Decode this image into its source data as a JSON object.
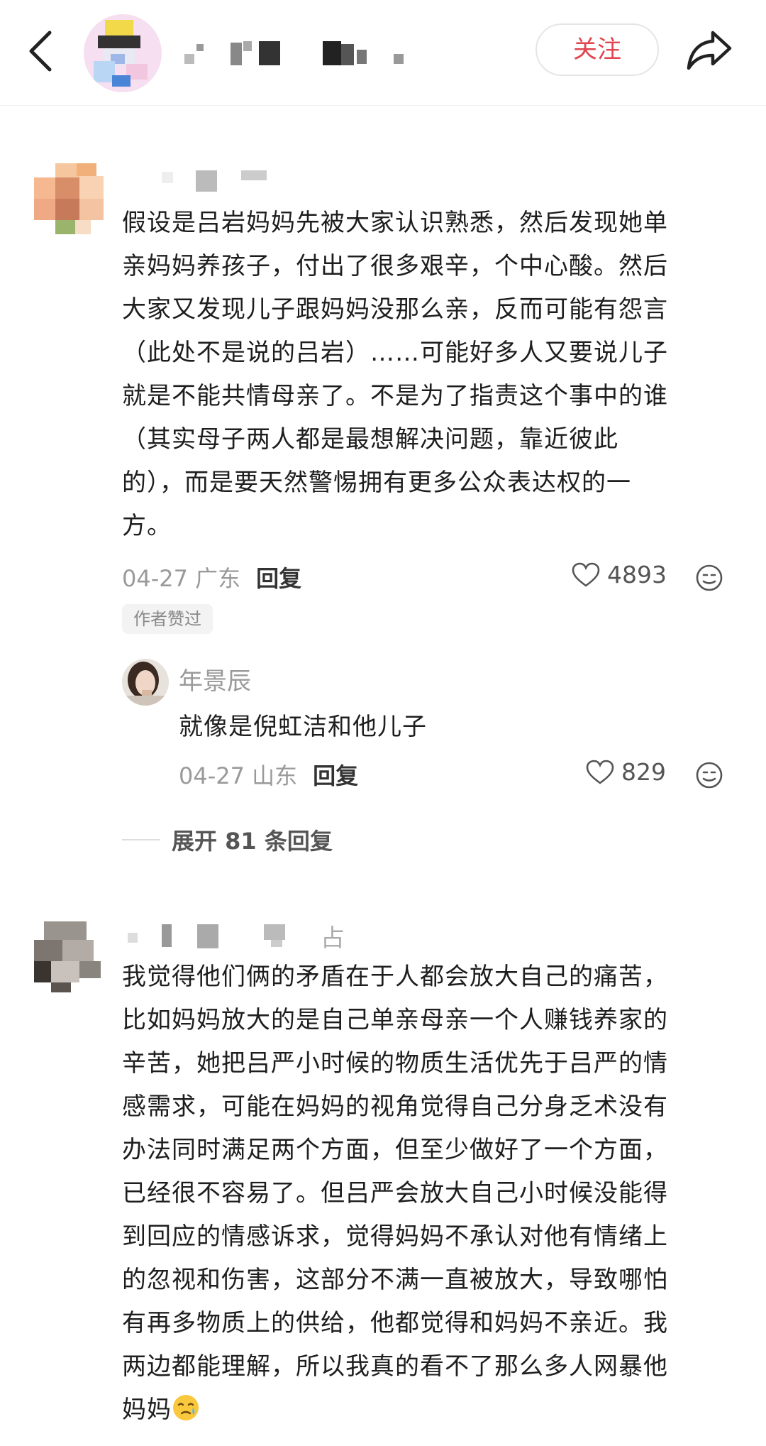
{
  "header": {
    "follow_label": "关注"
  },
  "comments": [
    {
      "text": "假设是吕岩妈妈先被大家认识熟悉，然后发现她单亲妈妈养孩子，付出了很多艰辛，个中心酸。然后大家又发现儿子跟妈妈没那么亲，反而可能有怨言（此处不是说的吕岩）……可能好多人又要说儿子就是不能共情母亲了。不是为了指责这个事中的谁（其实母子两人都是最想解决问题，靠近彼此的），而是要天然警惕拥有更多公众表达权的一方。",
      "lines": [
        "假设是吕岩妈妈先被大家认识熟悉，然后发现她单",
        "亲妈妈养孩子，付出了很多艰辛，个中心酸。然后",
        "大家又发现儿子跟妈妈没那么亲，反而可能有怨言",
        "（此处不是说的吕岩）……可能好多人又要说儿子",
        "就是不能共情母亲了。不是为了指责这个事中的谁",
        "（其实母子两人都是最想解决问题，靠近彼此",
        "的），而是要天然警惕拥有更多公众表达权的一",
        "方。"
      ],
      "date_location": "04-27 广东",
      "reply_label": "回复",
      "likes": "4893",
      "badge": "作者赞过",
      "sub_reply": {
        "name": "年景辰",
        "text": "就像是倪虹洁和他儿子",
        "date_location": "04-27 山东",
        "reply_label": "回复",
        "likes": "829"
      },
      "expand_label": "展开 81 条回复"
    },
    {
      "lines": [
        "我觉得他们俩的矛盾在于人都会放大自己的痛苦，",
        "比如妈妈放大的是自己单亲母亲一个人赚钱养家的",
        "辛苦，她把吕严小时候的物质生活优先于吕严的情",
        "感需求，可能在妈妈的视角觉得自己分身乏术没有",
        "办法同时满足两个方面，但至少做好了一个方面，",
        "已经很不容易了。但吕严会放大自己小时候没能得",
        "到回应的情感诉求，觉得妈妈不承认对他有情绪上",
        "的忽视和伤害，这部分不满一直被放大，导致哪怕",
        "有再多物质上的供给，他都觉得和妈妈不亲近。我",
        "两边都能理解，所以我真的看不了那么多人网暴他",
        "妈妈"
      ],
      "username_tail": "占"
    }
  ],
  "colors": {
    "accent_red": "#e0444f",
    "muted": "#9a9a9a"
  },
  "icons": [
    "back-icon",
    "share-icon",
    "heart-icon",
    "emoji-reply-icon",
    "crying-face-icon"
  ]
}
